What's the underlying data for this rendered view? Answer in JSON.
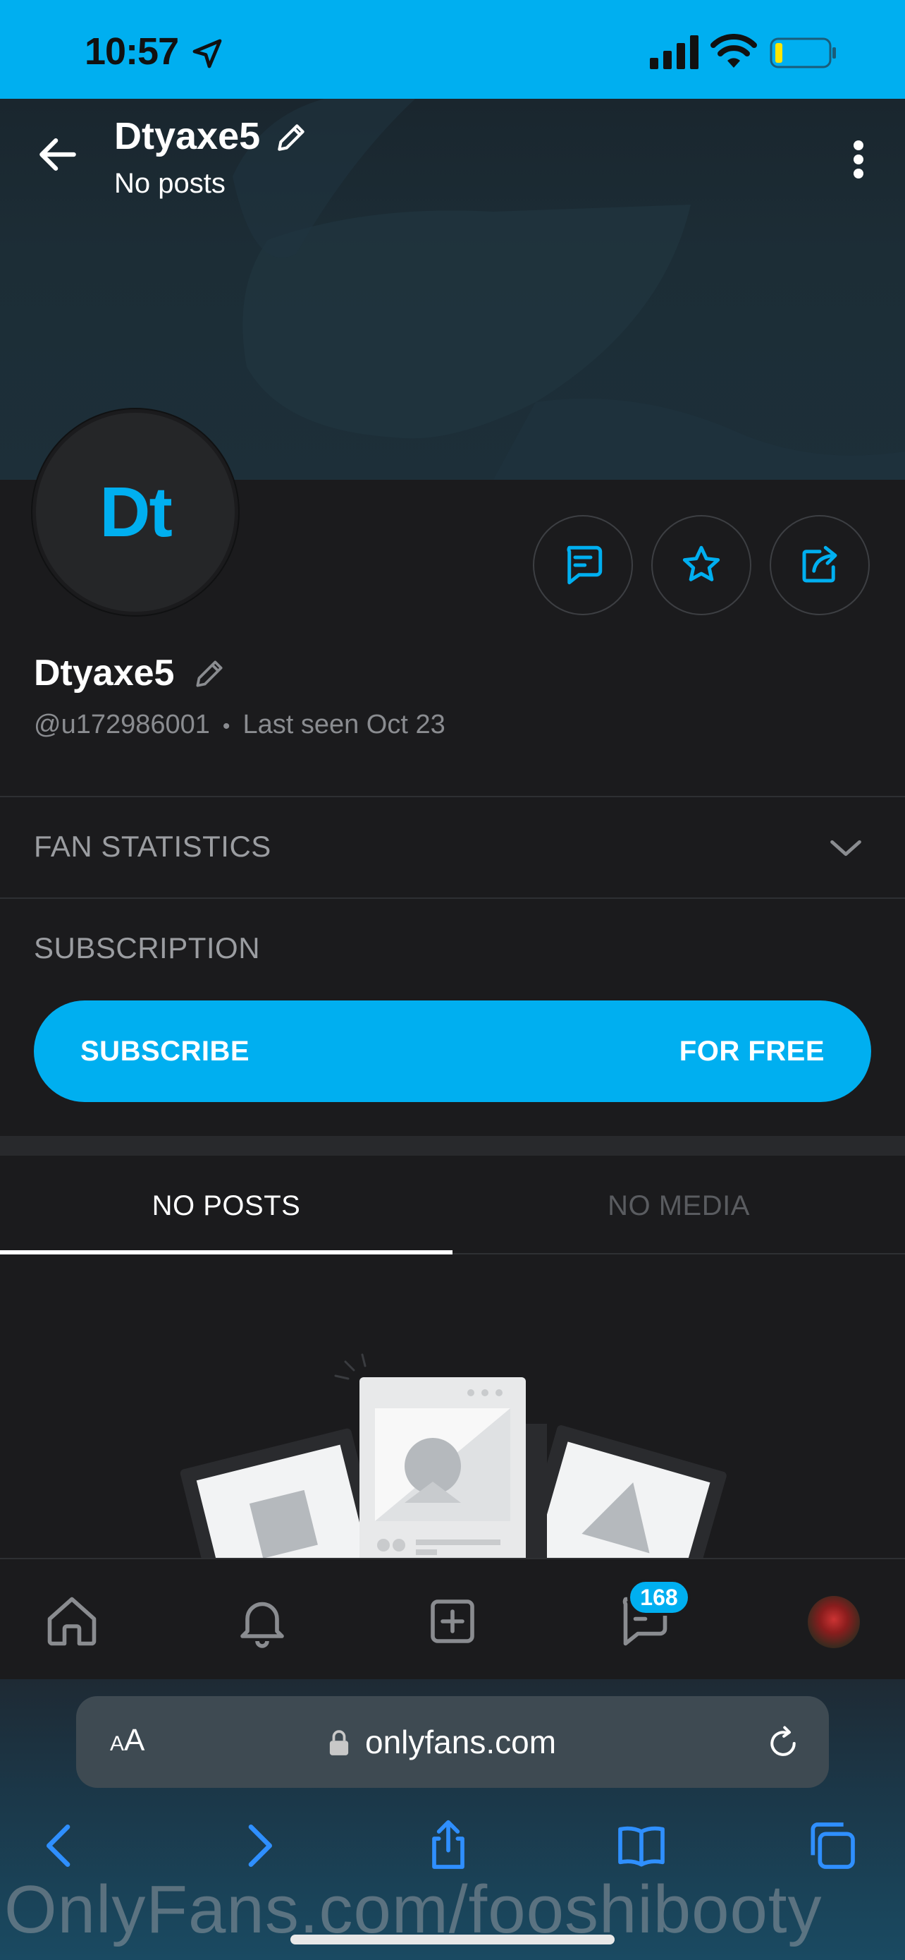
{
  "status_bar": {
    "time": "10:57"
  },
  "header": {
    "title": "Dtyaxe5",
    "subtitle": "No posts"
  },
  "profile": {
    "avatar_initials": "Dt",
    "name": "Dtyaxe5",
    "handle": "@u172986001",
    "separator": "•",
    "last_seen": "Last seen Oct 23"
  },
  "sections": {
    "fan_statistics": "FAN STATISTICS",
    "subscription": "SUBSCRIPTION"
  },
  "subscribe": {
    "label": "SUBSCRIBE",
    "price": "FOR FREE"
  },
  "tabs": [
    {
      "label": "NO POSTS",
      "active": true
    },
    {
      "label": "NO MEDIA",
      "active": false
    }
  ],
  "bottom_nav": {
    "items": [
      "home-icon",
      "bell-icon",
      "add-post-icon",
      "messages-icon",
      "profile-avatar"
    ],
    "messages_badge": "168"
  },
  "browser": {
    "text_size_label": "AA",
    "url": "onlyfans.com",
    "watermark": "OnlyFans.com/fooshibooty"
  },
  "colors": {
    "accent": "#00aff0",
    "background": "#1b1b1d"
  }
}
